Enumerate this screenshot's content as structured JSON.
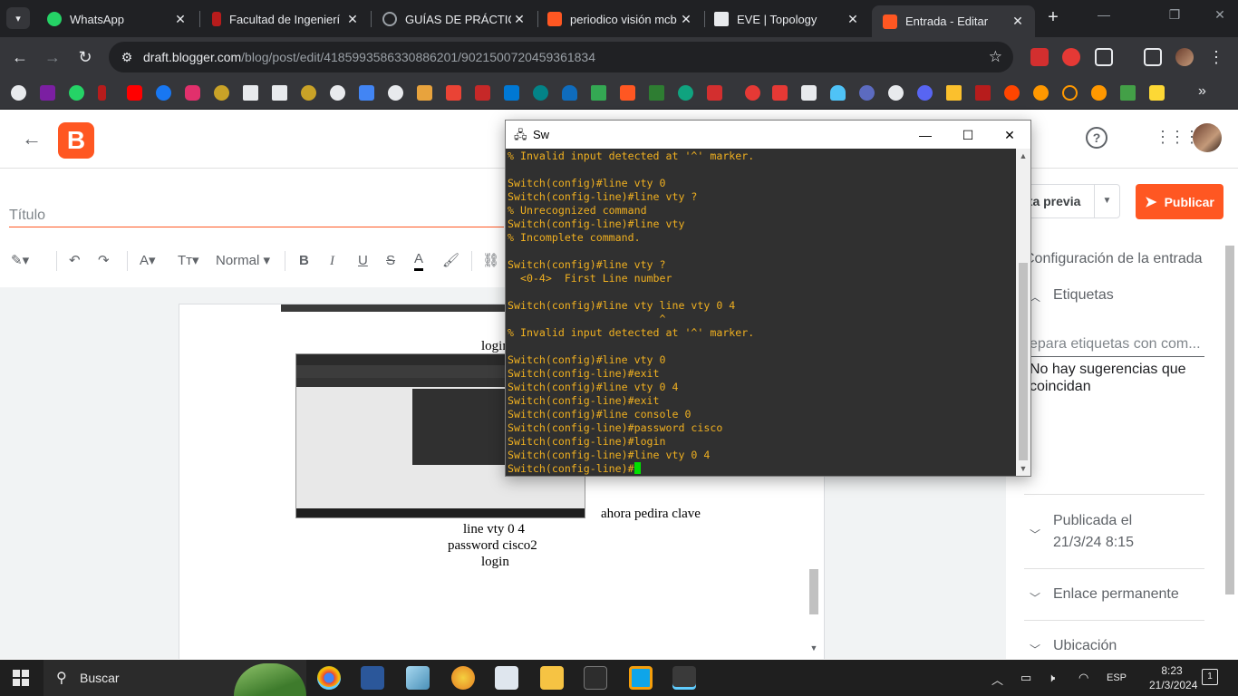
{
  "tabs": [
    {
      "label": "WhatsApp",
      "icon": "whatsapp-icon",
      "color": "#25d366"
    },
    {
      "label": "Facultad de Ingenierí",
      "icon": "faculty-icon",
      "color": "#b71c1c"
    },
    {
      "label": "GUÍAS DE PRÁCTICAS",
      "icon": "globe-icon",
      "color": "#9aa0a6"
    },
    {
      "label": "periodico visión mcb",
      "icon": "blogger-icon",
      "color": "#ff5722"
    },
    {
      "label": "EVE | Topology",
      "icon": "eve-icon",
      "color": "#e8eaed"
    },
    {
      "label": "Entrada - Editar",
      "icon": "blogger-icon",
      "color": "#ff5722"
    }
  ],
  "address": {
    "domain": "draft.blogger.com",
    "path": "/blog/post/edit/4185993586330886201/9021500720459361834"
  },
  "blogger": {
    "title_placeholder": "Título",
    "format_label": "Normal",
    "preview_label": "sta previa",
    "publish_label": "Publicar",
    "settings_label": "Configuración de la entrada",
    "labels_label": "Etiquetas",
    "labels_placeholder": "epara etiquetas con com...",
    "no_suggestions_1": "No hay sugerencias que",
    "no_suggestions_2": "coincidan",
    "published_label": "Publicada el",
    "published_date": "21/3/24 8:15",
    "permalink_label": "Enlace permanente",
    "location_label": "Ubicación"
  },
  "doc": {
    "login_top": "login",
    "caption_right": "ahora pedira clave",
    "line1": "line vty 0 4",
    "line2": "password cisco2",
    "line3": "login"
  },
  "terminal": {
    "title": "Sw",
    "lines": [
      "% Invalid input detected at '^' marker.",
      "",
      "Switch(config)#line vty 0",
      "Switch(config-line)#line vty ?",
      "% Unrecognized command",
      "Switch(config-line)#line vty",
      "% Incomplete command.",
      "",
      "Switch(config)#line vty ?",
      "  <0-4>  First Line number",
      "",
      "Switch(config)#line vty line vty 0 4",
      "                        ^",
      "% Invalid input detected at '^' marker.",
      "",
      "Switch(config)#line vty 0",
      "Switch(config-line)#exit",
      "Switch(config)#line vty 0 4",
      "Switch(config-line)#exit",
      "Switch(config)#line console 0",
      "Switch(config-line)#password cisco",
      "Switch(config-line)#login",
      "Switch(config-line)#line vty 0 4"
    ],
    "prompt": "Switch(config-line)#"
  },
  "taskbar": {
    "search_label": "Buscar",
    "lang": "ESP",
    "time": "8:23",
    "date": "21/3/2024",
    "notif_count": "1"
  }
}
